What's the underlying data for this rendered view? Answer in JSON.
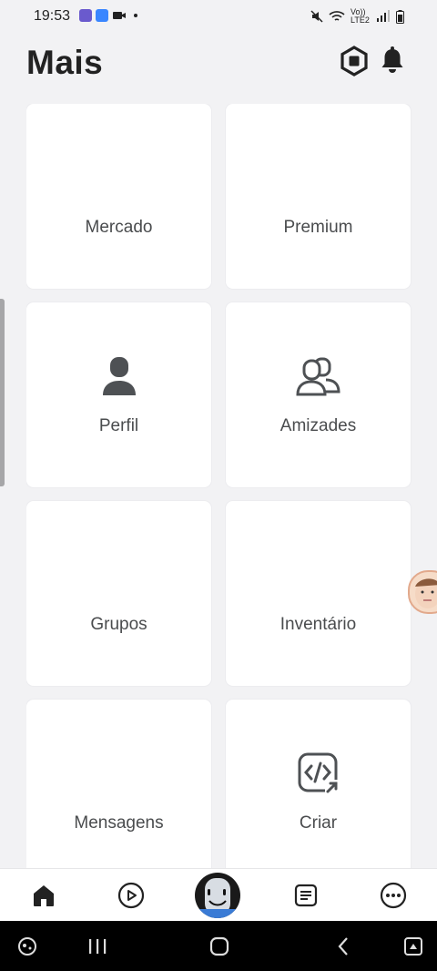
{
  "status_bar": {
    "time": "19:53",
    "network_text": "Vo)) LTE2"
  },
  "header": {
    "title": "Mais"
  },
  "tiles": [
    {
      "label": "Mercado",
      "icon": "none"
    },
    {
      "label": "Premium",
      "icon": "none"
    },
    {
      "label": "Perfil",
      "icon": "person-icon"
    },
    {
      "label": "Amizades",
      "icon": "friends-icon"
    },
    {
      "label": "Grupos",
      "icon": "none"
    },
    {
      "label": "Inventário",
      "icon": "none"
    },
    {
      "label": "Mensagens",
      "icon": "none"
    },
    {
      "label": "Criar",
      "icon": "create-code-icon"
    }
  ],
  "bottom_nav": [
    {
      "name": "home",
      "icon": "home-icon"
    },
    {
      "name": "play",
      "icon": "play-icon"
    },
    {
      "name": "avatar",
      "icon": "avatar-icon"
    },
    {
      "name": "chat",
      "icon": "chat-icon"
    },
    {
      "name": "more",
      "icon": "more-icon"
    }
  ],
  "colors": {
    "background": "#f2f2f4",
    "tile": "#ffffff",
    "text": "#4a4c4e",
    "title": "#222222"
  }
}
